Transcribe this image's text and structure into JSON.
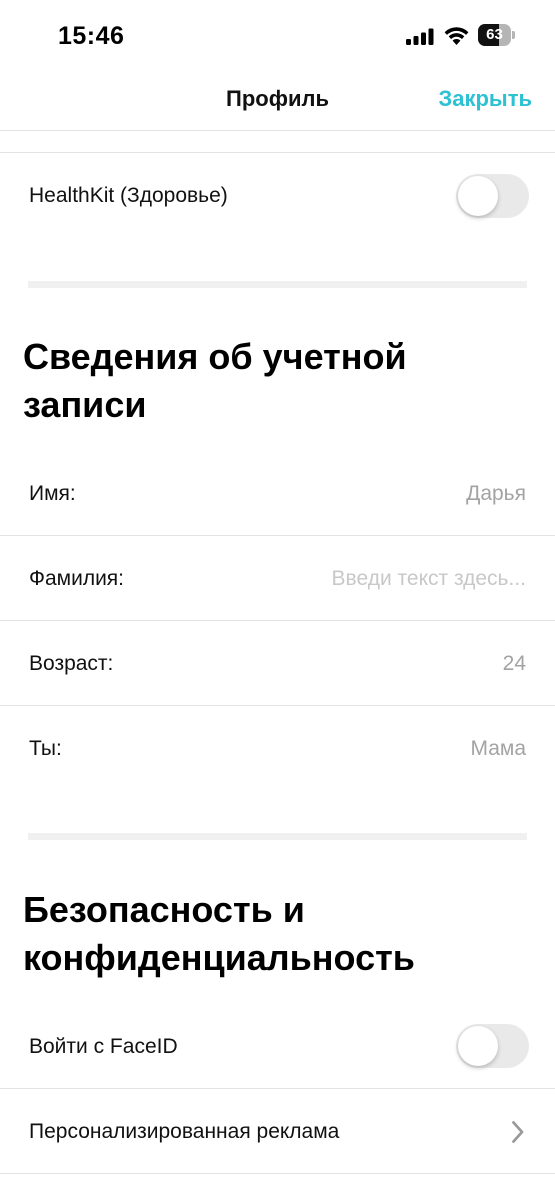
{
  "status_bar": {
    "time": "15:46",
    "battery": "63",
    "battery_level": 0.63
  },
  "nav": {
    "title": "Профиль",
    "close_label": "Закрыть",
    "accent_color": "#2cc2d4"
  },
  "healthkit": {
    "label": "HealthKit (Здоровье)",
    "enabled": false
  },
  "account": {
    "title": "Сведения об учетной записи",
    "rows": [
      {
        "label": "Имя:",
        "value": "Дарья",
        "is_placeholder": false
      },
      {
        "label": "Фамилия:",
        "value": "Введи текст здесь...",
        "is_placeholder": true
      },
      {
        "label": "Возраст:",
        "value": "24",
        "is_placeholder": false
      },
      {
        "label": "Ты:",
        "value": "Мама",
        "is_placeholder": false
      }
    ]
  },
  "security": {
    "title": "Безопасность и конфиденциальность",
    "faceid_label": "Войти с FaceID",
    "faceid_enabled": false,
    "ads_label": "Персонализированная реклама",
    "ads_icon": "chevron-right-icon"
  }
}
